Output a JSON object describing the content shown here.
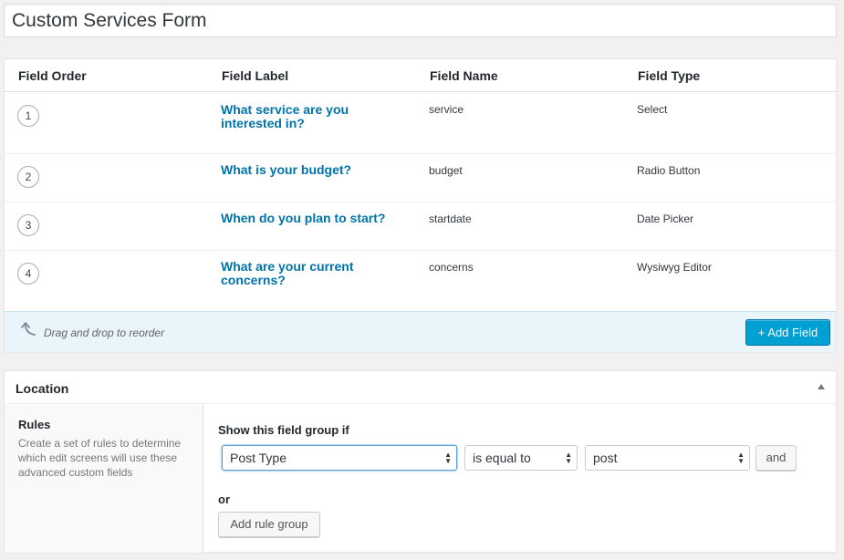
{
  "title": "Custom Services Form",
  "table": {
    "headers": [
      "Field Order",
      "Field Label",
      "Field Name",
      "Field Type"
    ],
    "rows": [
      {
        "order": "1",
        "label": "What service are you interested in?",
        "name": "service",
        "type": "Select"
      },
      {
        "order": "2",
        "label": "What is your budget?",
        "name": "budget",
        "type": "Radio Button"
      },
      {
        "order": "3",
        "label": "When do you plan to start?",
        "name": "startdate",
        "type": "Date Picker"
      },
      {
        "order": "4",
        "label": "What are your current concerns?",
        "name": "concerns",
        "type": "Wysiwyg Editor"
      }
    ],
    "footer": {
      "drag_text": "Drag and drop to reorder",
      "add_field_label": "+ Add Field"
    }
  },
  "location": {
    "title": "Location",
    "rules_label": "Rules",
    "rules_description": "Create a set of rules to determine which edit screens will use these advanced custom fields",
    "show_if": "Show this field group if",
    "param": "Post Type",
    "operator": "is equal to",
    "value": "post",
    "and_label": "and",
    "or_label": "or",
    "add_rule_group_label": "Add rule group"
  },
  "colors": {
    "link": "#0073aa",
    "primary_button": "#00a0d2",
    "footer_bg": "#e9f4fb"
  }
}
